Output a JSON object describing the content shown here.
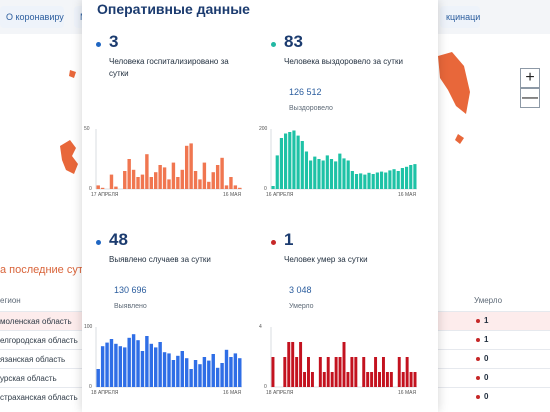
{
  "nav": {
    "pill_left": "О коронавирусе",
    "pill_mid": "М",
    "pill_right": "кцинация"
  },
  "map": {
    "zoom_in": "+",
    "zoom_out": "—"
  },
  "table": {
    "section_title": "а последние сутки",
    "col_region": "егион",
    "col_died": "Умерло",
    "rows": [
      {
        "name": "моленская область",
        "died": "1",
        "highlight": true
      },
      {
        "name": "елгородская область",
        "died": "1",
        "highlight": false
      },
      {
        "name": "язанская область",
        "died": "0",
        "highlight": false
      },
      {
        "name": "урская область",
        "died": "0",
        "highlight": false
      },
      {
        "name": "страханская область",
        "died": "0",
        "highlight": false
      }
    ]
  },
  "panel": {
    "title": "Оперативные данные",
    "cards": [
      {
        "value": "3",
        "desc": "Человека госпитализировано за сутки",
        "total": "",
        "total_label": "",
        "dot_color": "#1f66c2",
        "bar_color": "#f07650",
        "x_start": "17 АПРЕЛЯ",
        "x_end": "16 МАЯ",
        "y_max": "50",
        "y_min": "0"
      },
      {
        "value": "83",
        "desc": "Человека выздоровело за сутки",
        "total": "126 512",
        "total_label": "Выздоровело",
        "dot_color": "#22b8a3",
        "bar_color": "#1ec2a6",
        "x_start": "16 АПРЕЛЯ",
        "x_end": "16 МАЯ",
        "y_max": "200",
        "y_min": "0"
      },
      {
        "value": "48",
        "desc": "Выявлено случаев за сутки",
        "total": "130 696",
        "total_label": "Выявлено",
        "dot_color": "#1f66c2",
        "bar_color": "#2f6ee6",
        "x_start": "18 АПРЕЛЯ",
        "x_end": "16 МАЯ",
        "y_max": "100",
        "y_min": "0"
      },
      {
        "value": "1",
        "desc": "Человек умер за сутки",
        "total": "3 048",
        "total_label": "Умерло",
        "dot_color": "#c62828",
        "bar_color": "#c3121f",
        "x_start": "18 АПРЕЛЯ",
        "x_end": "16 МАЯ",
        "y_max": "4",
        "y_min": "0"
      }
    ]
  },
  "chart_data": [
    {
      "type": "bar",
      "title": "Человека госпитализировано за сутки",
      "ylim": [
        0,
        50
      ],
      "x_start": "17 АПРЕЛЯ",
      "x_end": "16 МАЯ",
      "values": [
        3,
        1,
        0,
        12,
        2,
        0,
        15,
        25,
        16,
        10,
        12,
        29,
        10,
        14,
        20,
        18,
        8,
        22,
        10,
        16,
        36,
        38,
        15,
        8,
        22,
        6,
        14,
        20,
        26,
        3,
        10,
        3,
        1
      ]
    },
    {
      "type": "bar",
      "title": "Человека выздоровело за сутки",
      "ylim": [
        0,
        200
      ],
      "x_start": "16 АПРЕЛЯ",
      "x_end": "16 МАЯ",
      "values": [
        10,
        112,
        170,
        185,
        190,
        195,
        178,
        160,
        125,
        95,
        108,
        100,
        95,
        112,
        100,
        92,
        118,
        102,
        95,
        60,
        50,
        52,
        48,
        54,
        50,
        55,
        58,
        55,
        62,
        66,
        60,
        70,
        74,
        80,
        83
      ]
    },
    {
      "type": "bar",
      "title": "Выявлено случаев за сутки",
      "ylim": [
        0,
        100
      ],
      "x_start": "18 АПРЕЛЯ",
      "x_end": "16 МАЯ",
      "values": [
        30,
        68,
        74,
        80,
        72,
        68,
        66,
        82,
        88,
        78,
        60,
        85,
        72,
        66,
        75,
        58,
        56,
        45,
        52,
        60,
        48,
        30,
        45,
        38,
        50,
        44,
        55,
        32,
        40,
        62,
        50,
        56,
        48
      ]
    },
    {
      "type": "bar",
      "title": "Человек умер за сутки",
      "ylim": [
        0,
        4
      ],
      "x_start": "18 АПРЕЛЯ",
      "x_end": "16 МАЯ",
      "values": [
        2,
        0,
        0,
        2,
        3,
        3,
        2,
        3,
        1,
        2,
        1,
        0,
        2,
        1,
        2,
        1,
        2,
        2,
        3,
        1,
        2,
        2,
        0,
        2,
        1,
        1,
        2,
        1,
        2,
        1,
        1,
        0,
        2,
        1,
        2,
        1,
        1
      ]
    }
  ]
}
